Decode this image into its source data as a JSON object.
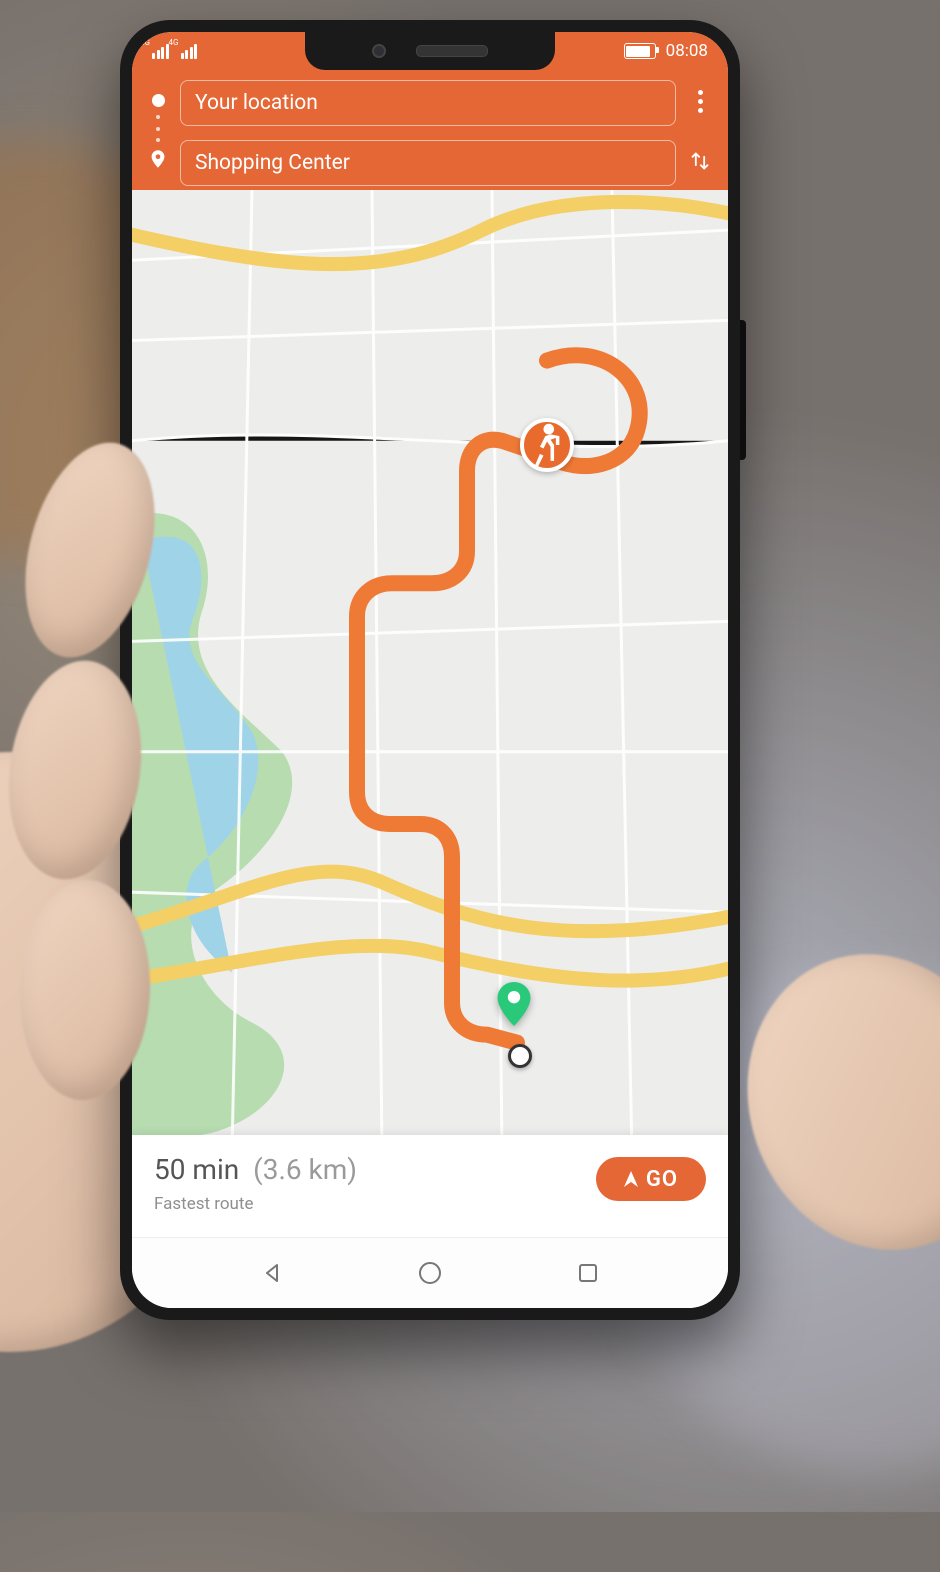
{
  "statusbar": {
    "network_indicator": "4G",
    "time": "08:08"
  },
  "search": {
    "origin_placeholder": "Your location",
    "destination_value": "Shopping Center"
  },
  "route": {
    "duration": "50 min",
    "distance": "(3.6 km)",
    "description": "Fastest route",
    "go_label": "GO"
  },
  "colors": {
    "accent": "#e56735",
    "route": "#ef7a36",
    "destination_pin": "#2ac97a"
  }
}
